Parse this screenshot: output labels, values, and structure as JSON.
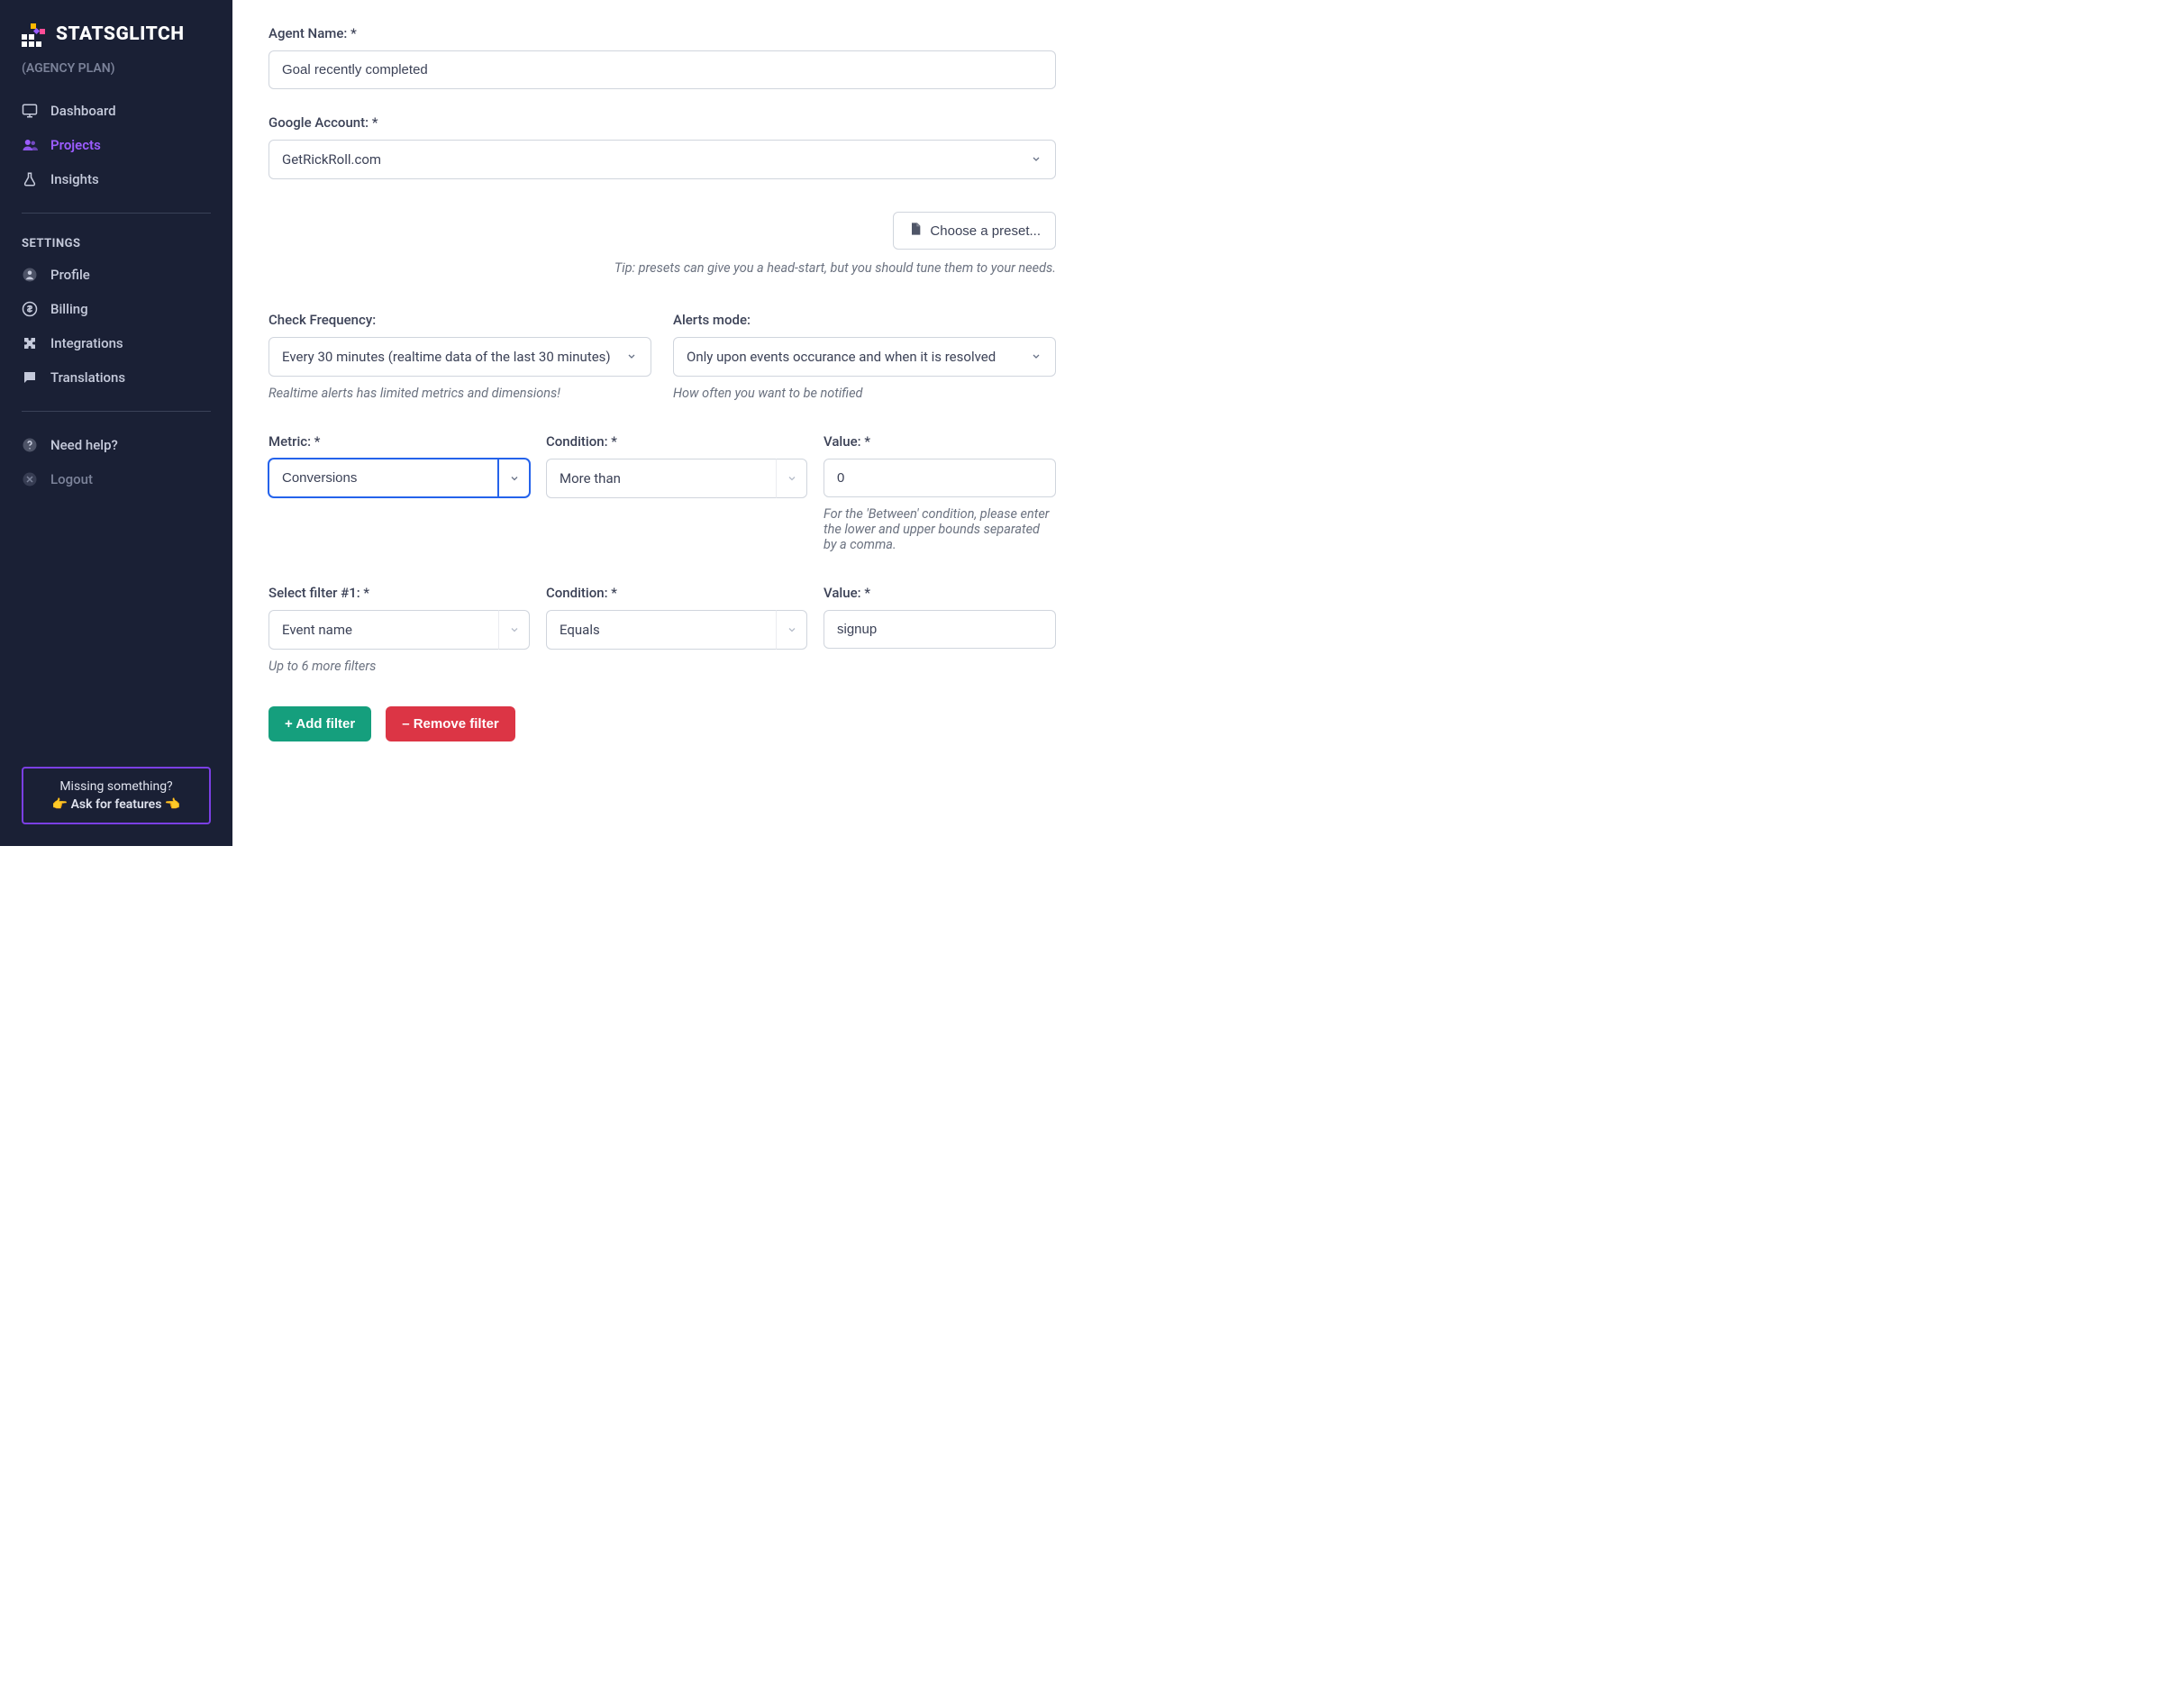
{
  "brand": {
    "name": "STATSGLITCH",
    "plan": "(AGENCY PLAN)"
  },
  "nav": {
    "dashboard": "Dashboard",
    "projects": "Projects",
    "insights": "Insights"
  },
  "settings": {
    "title": "SETTINGS",
    "profile": "Profile",
    "billing": "Billing",
    "integrations": "Integrations",
    "translations": "Translations"
  },
  "help": {
    "need_help": "Need help?",
    "logout": "Logout"
  },
  "feature_box": {
    "line1": "Missing something?",
    "line2_prefix": "👉",
    "line2_text": "Ask for features",
    "line2_suffix": "👈"
  },
  "form": {
    "agent_name_label": "Agent Name: *",
    "agent_name_value": "Goal recently completed",
    "google_account_label": "Google Account: *",
    "google_account_value": "GetRickRoll.com",
    "preset_button": "Choose a preset...",
    "preset_tip": "Tip: presets can give you a head-start, but you should tune them to your needs.",
    "check_frequency_label": "Check Frequency:",
    "check_frequency_value": "Every 30 minutes (realtime data of the last 30 minutes)",
    "check_frequency_hint": "Realtime alerts has limited metrics and dimensions!",
    "alerts_mode_label": "Alerts mode:",
    "alerts_mode_value": "Only upon events occurance and when it is resolved",
    "alerts_mode_hint": "How often you want to be notified",
    "metric_label": "Metric: *",
    "metric_value": "Conversions",
    "condition_label": "Condition: *",
    "condition_value": "More than",
    "value_label": "Value: *",
    "value_value": "0",
    "value_hint": "For the 'Between' condition, please enter the lower and upper bounds separated by a comma.",
    "filter1_label": "Select filter #1: *",
    "filter1_value": "Event name",
    "filter1_condition_label": "Condition: *",
    "filter1_condition_value": "Equals",
    "filter1_value_label": "Value: *",
    "filter1_value_value": "signup",
    "filter_hint": "Up to 6 more filters",
    "add_filter": "+ Add filter",
    "remove_filter": "– Remove filter"
  }
}
